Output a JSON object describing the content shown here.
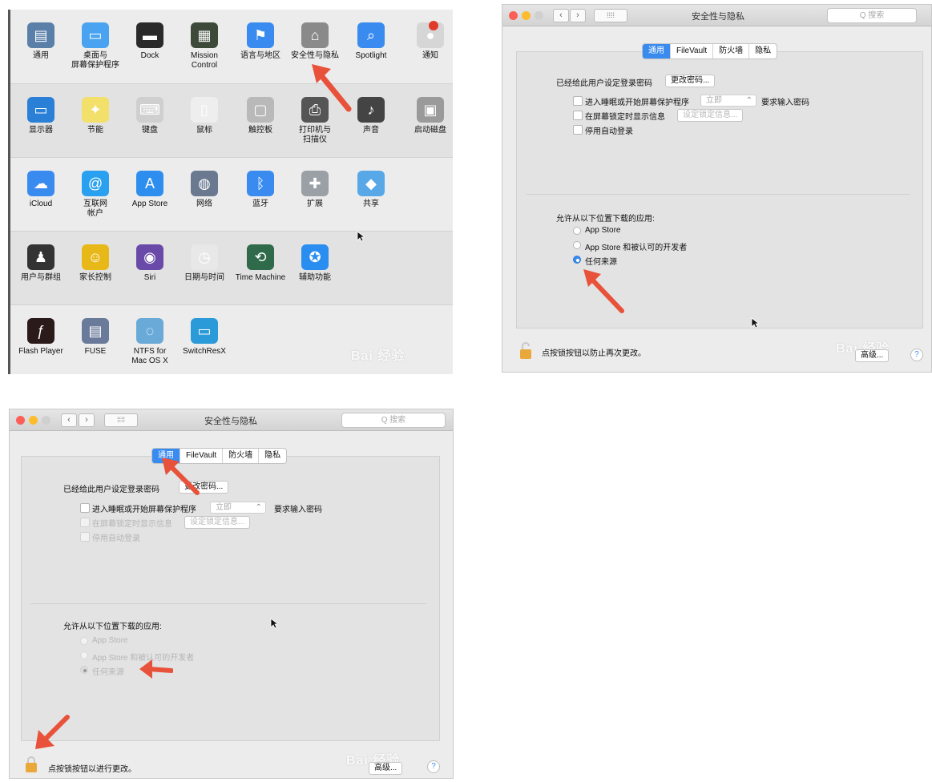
{
  "prefs_panel": {
    "rows": [
      [
        {
          "label": "通用",
          "icon": "general-icon",
          "color": "#5a7fa8"
        },
        {
          "label": "桌面与\n屏幕保护程序",
          "icon": "desktop-icon",
          "color": "#4aa3f0"
        },
        {
          "label": "Dock",
          "icon": "dock-icon",
          "color": "#2a2a2a"
        },
        {
          "label": "Mission\nControl",
          "icon": "mission-control-icon",
          "color": "#3d4a3a"
        },
        {
          "label": "语言与地区",
          "icon": "language-flag-icon",
          "color": "#3a8bf0"
        },
        {
          "label": "安全性与隐私",
          "icon": "security-house-icon",
          "color": "#8a8a8a"
        },
        {
          "label": "Spotlight",
          "icon": "spotlight-icon",
          "color": "#3a8bf0"
        },
        {
          "label": "通知",
          "icon": "notifications-icon",
          "color": "#d6d6d6"
        }
      ],
      [
        {
          "label": "显示器",
          "icon": "display-icon",
          "color": "#2a7fd6"
        },
        {
          "label": "节能",
          "icon": "bulb-icon",
          "color": "#f2e06a"
        },
        {
          "label": "键盘",
          "icon": "keyboard-icon",
          "color": "#cfcfcf"
        },
        {
          "label": "鼠标",
          "icon": "mouse-icon",
          "color": "#eeeeee"
        },
        {
          "label": "触控板",
          "icon": "trackpad-icon",
          "color": "#b9b9b9"
        },
        {
          "label": "打印机与\n扫描仪",
          "icon": "printer-icon",
          "color": "#555555"
        },
        {
          "label": "声音",
          "icon": "speaker-icon",
          "color": "#444444"
        },
        {
          "label": "启动磁盘",
          "icon": "disk-icon",
          "color": "#9a9a9a"
        }
      ],
      [
        {
          "label": "iCloud",
          "icon": "icloud-icon",
          "color": "#3a8bf0"
        },
        {
          "label": "互联网\n帐户",
          "icon": "at-icon",
          "color": "#2aa0f0"
        },
        {
          "label": "App Store",
          "icon": "appstore-icon",
          "color": "#2e8ef0"
        },
        {
          "label": "网络",
          "icon": "network-globe-icon",
          "color": "#6a7890"
        },
        {
          "label": "蓝牙",
          "icon": "bluetooth-icon",
          "color": "#3a8bf0"
        },
        {
          "label": "扩展",
          "icon": "puzzle-icon",
          "color": "#9aa0a6"
        },
        {
          "label": "共享",
          "icon": "sharing-folder-icon",
          "color": "#58a8e8"
        }
      ],
      [
        {
          "label": "用户与群组",
          "icon": "users-icon",
          "color": "#333333"
        },
        {
          "label": "家长控制",
          "icon": "parental-icon",
          "color": "#e8b818"
        },
        {
          "label": "Siri",
          "icon": "siri-icon",
          "color": "#6a4aa8"
        },
        {
          "label": "日期与时间",
          "icon": "clock-icon",
          "color": "#e8e8e8"
        },
        {
          "label": "Time Machine",
          "icon": "time-machine-icon",
          "color": "#2f6a4a"
        },
        {
          "label": "辅助功能",
          "icon": "accessibility-icon",
          "color": "#2a8ef0"
        }
      ],
      [
        {
          "label": "Flash Player",
          "icon": "flash-icon",
          "color": "#2a1a1a"
        },
        {
          "label": "FUSE",
          "icon": "fuse-icon",
          "color": "#6a7a9a"
        },
        {
          "label": "NTFS for\nMac OS X",
          "icon": "ntfs-icon",
          "color": "#6aaad8"
        },
        {
          "label": "SwitchResX",
          "icon": "switchresx-icon",
          "color": "#2a9ad8"
        }
      ]
    ],
    "watermark": "Bai 经验"
  },
  "window_unlocked": {
    "title": "安全性与隐私",
    "search_placeholder": "Q 搜索",
    "tabs": [
      "通用",
      "FileVault",
      "防火墙",
      "隐私"
    ],
    "login_password_text": "已经给此用户设定登录密码",
    "change_password_button": "更改密码...",
    "require_password_label": "进入睡眠或开始屏幕保护程序",
    "require_password_select": "立即",
    "require_password_suffix": "要求输入密码",
    "show_message_label": "在屏幕锁定时显示信息",
    "set_lock_message_button": "设定锁定信息...",
    "disable_autologin_label": "停用自动登录",
    "allow_apps_heading": "允许从以下位置下载的应用:",
    "options": [
      "App Store",
      "App Store 和被认可的开发者",
      "任何来源"
    ],
    "selected_option": "任何来源",
    "lock_text": "点按锁按钮以防止再次更改。",
    "advanced_button": "高级...",
    "help_label": "?",
    "watermark": "Bai 经验"
  },
  "window_locked": {
    "title": "安全性与隐私",
    "search_placeholder": "Q 搜索",
    "tabs": [
      "通用",
      "FileVault",
      "防火墙",
      "隐私"
    ],
    "login_password_text": "已经给此用户设定登录密码",
    "change_password_button": "更改密码...",
    "require_password_label": "进入睡眠或开始屏幕保护程序",
    "require_password_select": "立即",
    "require_password_suffix": "要求输入密码",
    "show_message_label": "在屏幕锁定时显示信息",
    "set_lock_message_button": "设定锁定信息...",
    "disable_autologin_label": "停用自动登录",
    "allow_apps_heading": "允许从以下位置下载的应用:",
    "options": [
      "App Store",
      "App Store 和被认可的开发者",
      "任何来源"
    ],
    "selected_option": "任何来源",
    "lock_text": "点按锁按钮以进行更改。",
    "advanced_button": "高级...",
    "help_label": "?",
    "watermark": "Bai 经验"
  },
  "colors": {
    "accent": "#3a8bf0",
    "annotation_arrow": "#e8523a",
    "close": "#fc5f57",
    "minimize": "#fdbc2e",
    "zoom": "#d0d0d0"
  }
}
